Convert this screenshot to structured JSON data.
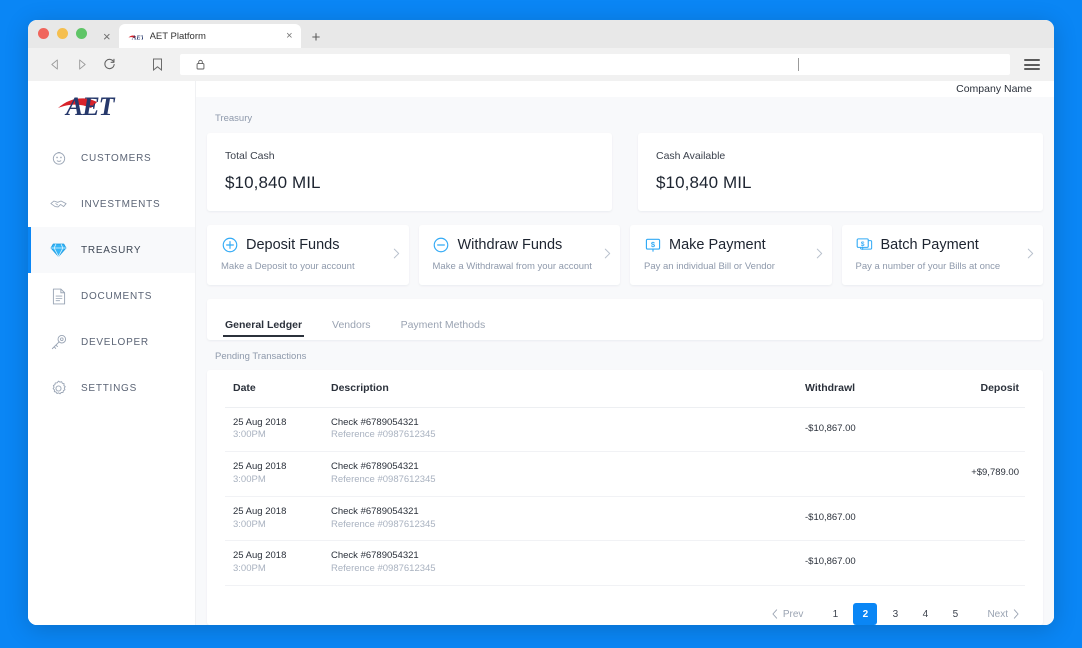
{
  "browser": {
    "tab_title": "AET Platform",
    "tab_favicon": "aet-logo-icon",
    "new_tab_label": "+",
    "strip_close_label": "×",
    "tab_close_label": "×",
    "address_value": "",
    "back_icon": "back-arrow-icon",
    "forward_icon": "forward-arrow-icon",
    "reload_icon": "reload-icon",
    "bookmark_icon": "bookmark-icon",
    "lock_icon": "padlock-icon",
    "menu_icon": "hamburger-menu-icon"
  },
  "header": {
    "logo_text": "AET",
    "company_name": "Company Name"
  },
  "sidebar": {
    "items": [
      {
        "label": "CUSTOMERS",
        "icon": "person-circle-icon",
        "active": false
      },
      {
        "label": "INVESTMENTS",
        "icon": "handshake-icon",
        "active": false
      },
      {
        "label": "TREASURY",
        "icon": "diamond-icon",
        "active": true
      },
      {
        "label": "DOCUMENTS",
        "icon": "document-icon",
        "active": false
      },
      {
        "label": "DEVELOPER",
        "icon": "key-icon",
        "active": false
      },
      {
        "label": "SETTINGS",
        "icon": "gear-icon",
        "active": false
      }
    ]
  },
  "main": {
    "section_label": "Treasury",
    "kpis": [
      {
        "title": "Total Cash",
        "value": "$10,840 MIL"
      },
      {
        "title": "Cash Available",
        "value": "$10,840 MIL"
      }
    ],
    "actions": [
      {
        "title": "Deposit  Funds",
        "subtitle": "Make a Deposit to your account",
        "icon": "plus-circle-icon",
        "chevron": "chevron-right-icon"
      },
      {
        "title": "Withdraw  Funds",
        "subtitle": "Make a Withdrawal from your account",
        "icon": "minus-circle-icon",
        "chevron": "chevron-right-icon"
      },
      {
        "title": "Make Payment",
        "subtitle": "Pay an individual Bill or Vendor",
        "icon": "payment-bill-icon",
        "chevron": "chevron-right-icon"
      },
      {
        "title": "Batch Payment",
        "subtitle": "Pay a number of your Bills at once",
        "icon": "batch-payment-icon",
        "chevron": "chevron-right-icon"
      }
    ],
    "tabs": [
      {
        "label": "General Ledger",
        "active": true
      },
      {
        "label": "Vendors",
        "active": false
      },
      {
        "label": "Payment Methods",
        "active": false
      }
    ],
    "table_label": "Pending Transactions",
    "table": {
      "columns": [
        "Date",
        "Description",
        "Withdrawl",
        "Deposit"
      ],
      "rows": [
        {
          "date": "25 Aug 2018",
          "time": "3:00PM",
          "description": "Check #6789054321",
          "reference": "Reference #0987612345",
          "withdrawal": "-$10,867.00",
          "deposit": ""
        },
        {
          "date": "25 Aug 2018",
          "time": "3:00PM",
          "description": "Check #6789054321",
          "reference": "Reference #0987612345",
          "withdrawal": "",
          "deposit": "+$9,789.00"
        },
        {
          "date": "25 Aug 2018",
          "time": "3:00PM",
          "description": "Check #6789054321",
          "reference": "Reference #0987612345",
          "withdrawal": "-$10,867.00",
          "deposit": ""
        },
        {
          "date": "25 Aug 2018",
          "time": "3:00PM",
          "description": "Check #6789054321",
          "reference": "Reference #0987612345",
          "withdrawal": "-$10,867.00",
          "deposit": ""
        }
      ]
    },
    "pagination": {
      "prev_label": "Prev",
      "next_label": "Next",
      "pages": [
        "1",
        "2",
        "3",
        "4",
        "5"
      ],
      "current": "2"
    }
  },
  "colors": {
    "accent": "#0a86f5",
    "page_background": "#0a86f5",
    "icon_blue": "#32aaf5",
    "logo_navy": "#26386b",
    "logo_red": "#d8232a"
  }
}
